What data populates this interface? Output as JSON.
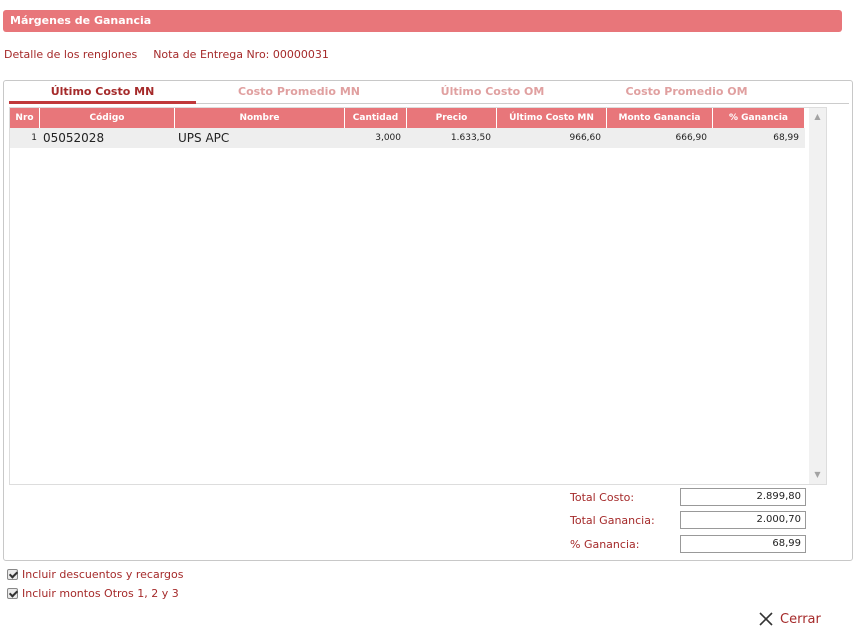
{
  "window": {
    "title": "Márgenes de Ganancia",
    "detail_label": "Detalle de los renglones",
    "delivery_note": "Nota de Entrega Nro: 00000031"
  },
  "tabs": [
    {
      "label": "Último Costo MN",
      "active": true
    },
    {
      "label": "Costo Promedio MN",
      "active": false
    },
    {
      "label": "Último Costo OM",
      "active": false
    },
    {
      "label": "Costo Promedio OM",
      "active": false
    }
  ],
  "grid": {
    "columns": [
      "Nro",
      "Código",
      "Nombre",
      "Cantidad",
      "Precio",
      "Último Costo MN",
      "Monto Ganancia",
      "% Ganancia"
    ],
    "rows": [
      {
        "nro": "1",
        "codigo": "05052028",
        "nombre": "UPS APC",
        "cantidad": "3,000",
        "precio": "1.633,50",
        "ultimo_costo": "966,60",
        "monto_ganancia": "666,90",
        "porc_ganancia": "68,99"
      }
    ]
  },
  "totals": {
    "total_costo_label": "Total Costo:",
    "total_costo_value": "2.899,80",
    "total_ganancia_label": "Total Ganancia:",
    "total_ganancia_value": "2.000,70",
    "porc_ganancia_label": "% Ganancia:",
    "porc_ganancia_value": "68,99"
  },
  "options": {
    "incluir_descuentos": "Incluir descuentos y recargos",
    "incluir_montos": "Incluir montos Otros 1, 2 y 3"
  },
  "actions": {
    "close_label": "Cerrar"
  },
  "colors": {
    "header": "#e8767a",
    "accent_text": "#a52a2a"
  },
  "icons": {
    "close": "close-icon",
    "checkbox": "checkbox-checked-icon"
  }
}
